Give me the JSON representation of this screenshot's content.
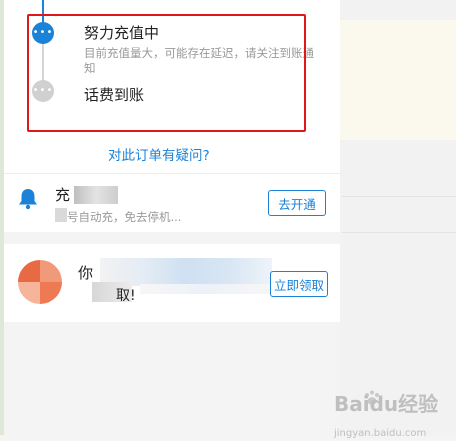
{
  "timeline": {
    "step1_title": "努力充值中",
    "step1_desc": "目前充值量大，可能存在延迟，请关注到账通知",
    "step2_title": "话费到账"
  },
  "order": {
    "question_link": "对此订单有疑问?"
  },
  "offer1": {
    "title": "充",
    "subtitle": "号自动充，免去停机...",
    "button_label": "去开通"
  },
  "offer2": {
    "title": "你",
    "subtitle": "取!",
    "button_label": "立即领取"
  },
  "watermark": {
    "text": "Baidu经验",
    "sub": "jingyan.baidu.com"
  },
  "colors": {
    "accent": "#1b82d8",
    "highlight_box": "#e0161b"
  },
  "icons": {
    "step1": "more-dots-icon",
    "step2": "more-dots-icon",
    "offer1": "bell-icon",
    "offer2": "avatar"
  }
}
